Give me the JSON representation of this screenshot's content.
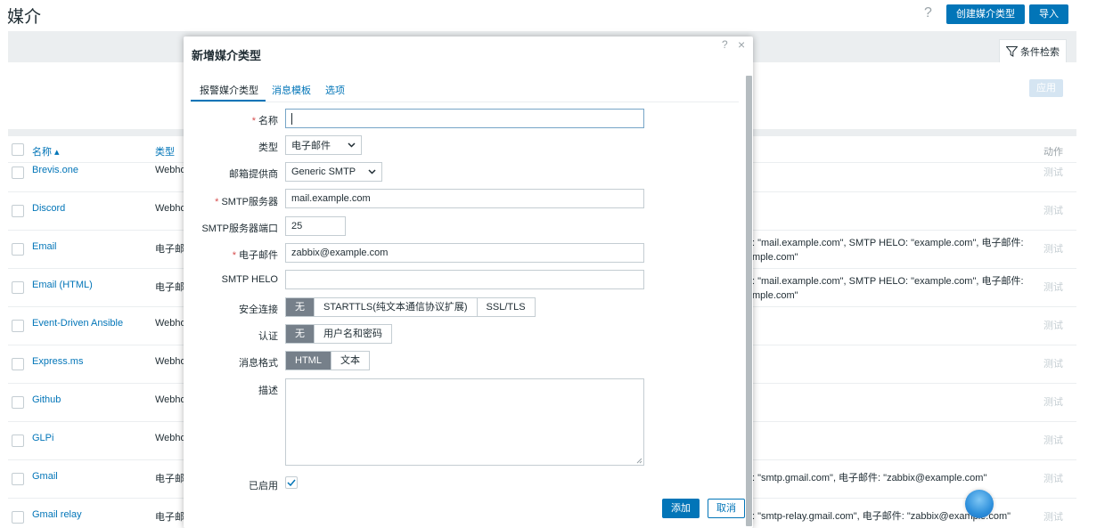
{
  "page": {
    "title": "媒介",
    "help": "?",
    "create_button": "创建媒介类型",
    "import_button": "导入"
  },
  "filter": {
    "tab_label": "条件检索",
    "apply_label": "应用"
  },
  "table": {
    "headers": {
      "name": "名称 ▴",
      "type": "类型",
      "action": "动作"
    },
    "rows": [
      {
        "name": "Brevis.one",
        "type": "Webho",
        "details": "",
        "action": "测试"
      },
      {
        "name": "Discord",
        "type": "Webho",
        "details": "",
        "action": "测试"
      },
      {
        "name": "Email",
        "type": "电子邮",
        "details": ": \"mail.example.com\", SMTP HELO: \"example.com\", 电子邮件: mple.com\"",
        "action": "测试"
      },
      {
        "name": "Email (HTML)",
        "type": "电子邮",
        "details": ": \"mail.example.com\", SMTP HELO: \"example.com\", 电子邮件: mple.com\"",
        "action": "测试"
      },
      {
        "name": "Event-Driven Ansible",
        "type": "Webho",
        "details": "",
        "action": "测试"
      },
      {
        "name": "Express.ms",
        "type": "Webho",
        "details": "",
        "action": "测试"
      },
      {
        "name": "Github",
        "type": "Webho",
        "details": "",
        "action": "测试"
      },
      {
        "name": "GLPi",
        "type": "Webho",
        "details": "",
        "action": "测试"
      },
      {
        "name": "Gmail",
        "type": "电子邮",
        "details": ": \"smtp.gmail.com\", 电子邮件: \"zabbix@example.com\"",
        "action": "测试"
      },
      {
        "name": "Gmail relay",
        "type": "电子邮",
        "details": ": \"smtp-relay.gmail.com\", 电子邮件: \"zabbix@example.com\"",
        "action": "测试"
      }
    ]
  },
  "modal": {
    "title": "新增媒介类型",
    "help": "?",
    "close": "×",
    "tabs": [
      "报警媒介类型",
      "消息模板",
      "选项"
    ],
    "form": {
      "name_label": "名称",
      "name_value": "",
      "type_label": "类型",
      "type_value": "电子邮件",
      "provider_label": "邮箱提供商",
      "provider_value": "Generic SMTP",
      "smtp_server_label": "SMTP服务器",
      "smtp_server_value": "mail.example.com",
      "smtp_port_label": "SMTP服务器端口",
      "smtp_port_value": "25",
      "email_label": "电子邮件",
      "email_value": "zabbix@example.com",
      "helo_label": "SMTP HELO",
      "helo_value": "",
      "security_label": "安全连接",
      "security_options": [
        "无",
        "STARTTLS(纯文本通信协议扩展)",
        "SSL/TLS"
      ],
      "auth_label": "认证",
      "auth_options": [
        "无",
        "用户名和密码"
      ],
      "format_label": "消息格式",
      "format_options": [
        "HTML",
        "文本"
      ],
      "description_label": "描述",
      "description_value": "",
      "enabled_label": "已启用"
    },
    "add_button": "添加",
    "cancel_button": "取消"
  }
}
